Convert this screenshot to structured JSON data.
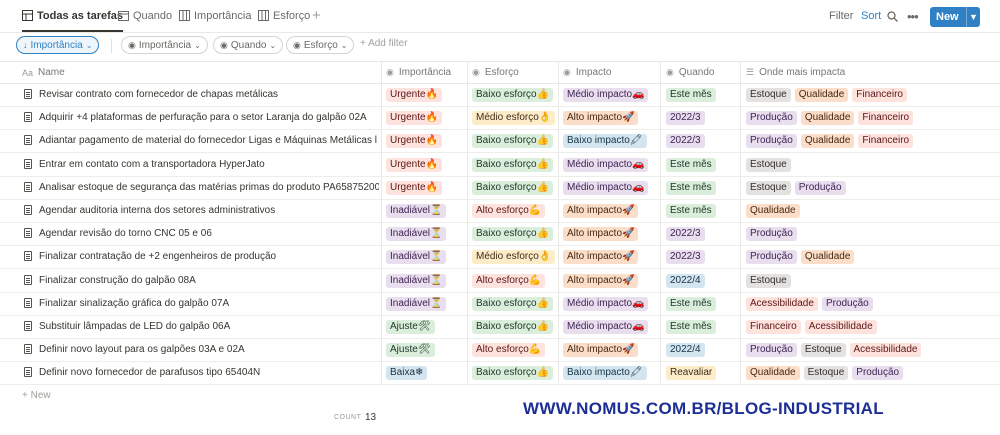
{
  "views": [
    {
      "label": "Todas as tarefas",
      "icon": "table-icon"
    },
    {
      "label": "Quando",
      "icon": "calendar-icon"
    },
    {
      "label": "Importância",
      "icon": "board-icon"
    },
    {
      "label": "Esforço",
      "icon": "board-icon"
    }
  ],
  "toolbar": {
    "filter": "Filter",
    "sort": "Sort",
    "new": "New"
  },
  "filters": {
    "sort_chip": "Importância",
    "chips": [
      "Importância",
      "Quando",
      "Esforço"
    ],
    "add_filter": "Add filter"
  },
  "columns": [
    "Name",
    "Importância",
    "Esforço",
    "Impacto",
    "Quando",
    "Onde mais impacta"
  ],
  "rows": [
    {
      "name": "Revisar contrato com fornecedor de chapas metálicas",
      "importancia": "Urgente🔥",
      "esforco": "Baixo esforço👍",
      "impacto": "Médio impacto🚗",
      "quando": "Este mês",
      "onde": [
        "Estoque",
        "Qualidade",
        "Financeiro"
      ]
    },
    {
      "name": "Adquirir +4 plataformas de perfuração para o setor Laranja do galpão 02A",
      "importancia": "Urgente🔥",
      "esforco": "Médio esforço👌",
      "impacto": "Alto impacto🚀",
      "quando": "2022/3",
      "onde": [
        "Produção",
        "Qualidade",
        "Financeiro"
      ]
    },
    {
      "name": "Adiantar pagamento de material do fornecedor Ligas e Máquinas Metálicas l",
      "importancia": "Urgente🔥",
      "esforco": "Baixo esforço👍",
      "impacto": "Baixo impacto🖍",
      "quando": "2022/3",
      "onde": [
        "Produção",
        "Qualidade",
        "Financeiro"
      ]
    },
    {
      "name": "Entrar em contato com a transportadora HyperJato",
      "importancia": "Urgente🔥",
      "esforco": "Baixo esforço👍",
      "impacto": "Médio impacto🚗",
      "quando": "Este mês",
      "onde": [
        "Estoque"
      ]
    },
    {
      "name": "Analisar estoque de segurança das matérias primas do produto PA65875200",
      "importancia": "Urgente🔥",
      "esforco": "Baixo esforço👍",
      "impacto": "Médio impacto🚗",
      "quando": "Este mês",
      "onde": [
        "Estoque",
        "Produção"
      ]
    },
    {
      "name": "Agendar auditoria interna dos setores administrativos",
      "importancia": "Inadiável⏳",
      "esforco": "Alto esforço💪",
      "impacto": "Alto impacto🚀",
      "quando": "Este mês",
      "onde": [
        "Qualidade"
      ]
    },
    {
      "name": "Agendar revisão do torno CNC 05 e 06",
      "importancia": "Inadiável⏳",
      "esforco": "Baixo esforço👍",
      "impacto": "Alto impacto🚀",
      "quando": "2022/3",
      "onde": [
        "Produção"
      ]
    },
    {
      "name": "Finalizar contratação de +2 engenheiros de produção",
      "importancia": "Inadiável⏳",
      "esforco": "Médio esforço👌",
      "impacto": "Alto impacto🚀",
      "quando": "2022/3",
      "onde": [
        "Produção",
        "Qualidade"
      ]
    },
    {
      "name": "Finalizar construção do galpão 08A",
      "importancia": "Inadiável⏳",
      "esforco": "Alto esforço💪",
      "impacto": "Alto impacto🚀",
      "quando": "2022/4",
      "onde": [
        "Estoque"
      ]
    },
    {
      "name": "Finalizar sinalização gráfica do galpão 07A",
      "importancia": "Inadiável⏳",
      "esforco": "Baixo esforço👍",
      "impacto": "Médio impacto🚗",
      "quando": "Este mês",
      "onde": [
        "Acessibilidade",
        "Produção"
      ]
    },
    {
      "name": "Substituir lâmpadas de LED do galpão 06A",
      "importancia": "Ajuste🛠",
      "esforco": "Baixo esforço👍",
      "impacto": "Médio impacto🚗",
      "quando": "Este mês",
      "onde": [
        "Financeiro",
        "Acessibilidade"
      ]
    },
    {
      "name": "Definir novo layout para os galpões 03A e 02A",
      "importancia": "Ajuste🛠",
      "esforco": "Alto esforço💪",
      "impacto": "Alto impacto🚀",
      "quando": "2022/4",
      "onde": [
        "Produção",
        "Estoque",
        "Acessibilidade"
      ]
    },
    {
      "name": "Definir novo fornecedor de parafusos tipo 65404N",
      "importancia": "Baixa❄",
      "esforco": "Baixo esforço👍",
      "impacto": "Baixo impacto🖍",
      "quando": "Reavaliar",
      "onde": [
        "Qualidade",
        "Estoque",
        "Produção"
      ]
    }
  ],
  "tag_colors": {
    "Urgente": "#fde2dd",
    "Inadiável": "#e8deee",
    "Ajuste": "#dbeddb",
    "Baixa": "#d3e5ef",
    "Baixo esforço": "#dbeddb",
    "Médio esforço": "#fdecc8",
    "Alto esforço": "#fde2dd",
    "Médio impacto": "#e8deee",
    "Alto impacto": "#fadec9",
    "Baixo impacto": "#d3e5ef",
    "Este mês": "#dbeddb",
    "2022/3": "#e8deee",
    "2022/4": "#d3e5ef",
    "Reavaliar": "#fdecc8",
    "Estoque": "#e3e2e0",
    "Qualidade": "#fadec9",
    "Financeiro": "#fde2dd",
    "Produção": "#e8deee",
    "Acessibilidade": "#fde2dd"
  },
  "footer": {
    "new_row": "New",
    "count_label": "COUNT",
    "count_value": "13"
  },
  "watermark": "WWW.NOMUS.COM.BR/BLOG-INDUSTRIAL",
  "accent_color": "#2f80c4"
}
